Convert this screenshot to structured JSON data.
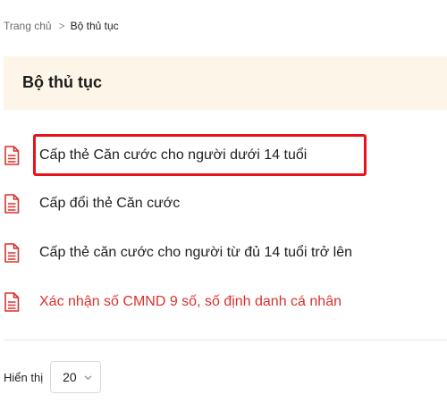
{
  "breadcrumb": {
    "home": "Trang chủ",
    "separator": ">",
    "current": "Bộ thủ tục"
  },
  "header": {
    "title": "Bộ thủ tục"
  },
  "procedures": [
    {
      "label": "Cấp thẻ Căn cước cho người dưới 14 tuổi",
      "icon": "document-icon",
      "highlighted_text": false,
      "selected_box": true
    },
    {
      "label": "Cấp đổi thẻ Căn cước",
      "icon": "document-icon",
      "highlighted_text": false,
      "selected_box": false
    },
    {
      "label": "Cấp thẻ căn cước cho người từ đủ 14 tuổi trở lên",
      "icon": "document-icon",
      "highlighted_text": false,
      "selected_box": false
    },
    {
      "label": "Xác nhận số CMND 9 số, số định danh cá nhân",
      "icon": "document-icon",
      "highlighted_text": true,
      "selected_box": false
    }
  ],
  "page_size": {
    "label": "Hiển thị",
    "value": "20"
  },
  "colors": {
    "header_background": "#fdf6e8",
    "icon_red": "#d8322c",
    "highlight_text": "#d8322c",
    "selection_border": "#e8121a"
  }
}
